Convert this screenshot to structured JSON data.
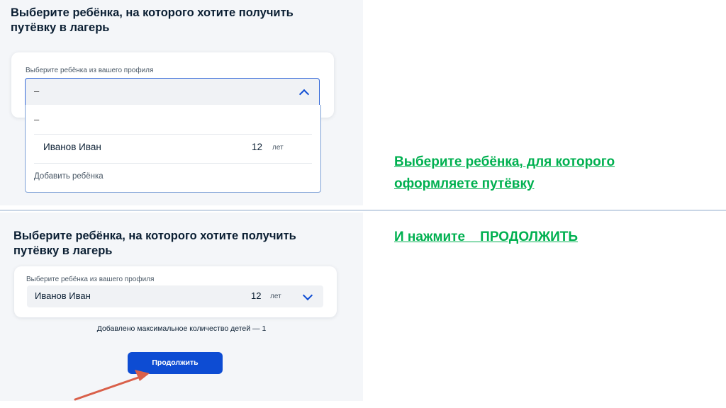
{
  "top_panel": {
    "title_line1": "Выберите ребёнка, на которого хотите получить",
    "title_line2": "путёвку в лагерь",
    "field_label": "Выберите ребёнка из вашего профиля",
    "select_value": "–",
    "options": {
      "empty": "–",
      "child_name": "Иванов Иван",
      "child_age": "12",
      "age_unit": "лет",
      "add_child": "Добавить ребёнка"
    }
  },
  "bottom_panel": {
    "title_line1": "Выберите ребёнка, на которого хотите получить",
    "title_line2": "путёвку в лагерь",
    "field_label": "Выберите ребёнка из вашего профиля",
    "selected_child_name": "Иванов Иван",
    "selected_child_age": "12",
    "age_unit": "лет",
    "info_note": "Добавлено максимальное количество детей — 1",
    "continue_label": "Продолжить"
  },
  "instructions": {
    "line1": "Выберите ребёнка, для которого",
    "line2": "оформляете путёвку",
    "line3": "И нажмите    ПРОДОЛЖИТЬ"
  },
  "colors": {
    "instruction_text": "#00b050",
    "primary_button": "#0d4cd3",
    "arrow": "#d9604a"
  },
  "icons": [
    "chevron-up-icon",
    "chevron-down-icon",
    "arrow-pointer"
  ]
}
